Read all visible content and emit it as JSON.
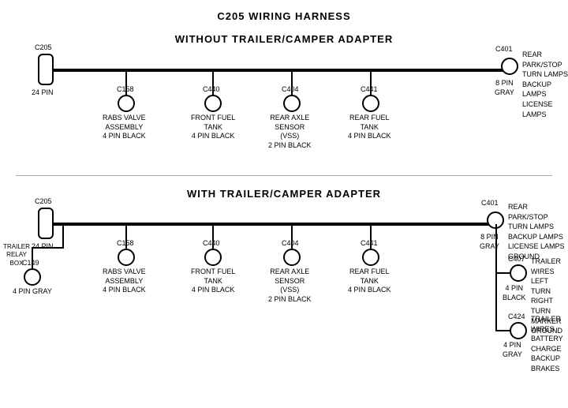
{
  "title": "C205 WIRING HARNESS",
  "section1": {
    "label": "WITHOUT  TRAILER/CAMPER  ADAPTER",
    "connectors": {
      "c205": {
        "label": "C205",
        "pin": "24 PIN"
      },
      "c401": {
        "label": "C401",
        "pin": "8 PIN\nGRAY",
        "desc": "REAR PARK/STOP\nTURN LAMPS\nBACKUP LAMPS\nLICENSE LAMPS"
      },
      "c158": {
        "label": "C158",
        "desc": "RABS VALVE\nASSEMBLY\n4 PIN BLACK"
      },
      "c440": {
        "label": "C440",
        "desc": "FRONT FUEL\nTANK\n4 PIN BLACK"
      },
      "c404": {
        "label": "C404",
        "desc": "REAR AXLE\nSENSOR\n(VSS)\n2 PIN BLACK"
      },
      "c441": {
        "label": "C441",
        "desc": "REAR FUEL\nTANK\n4 PIN BLACK"
      }
    }
  },
  "section2": {
    "label": "WITH  TRAILER/CAMPER  ADAPTER",
    "connectors": {
      "c205": {
        "label": "C205",
        "pin": "24 PIN"
      },
      "c401": {
        "label": "C401",
        "pin": "8 PIN\nGRAY",
        "desc": "REAR PARK/STOP\nTURN LAMPS\nBACKUP LAMPS\nLICENSE LAMPS\nGROUND"
      },
      "c158": {
        "label": "C158",
        "desc": "RABS VALVE\nASSEMBLY\n4 PIN BLACK"
      },
      "c440": {
        "label": "C440",
        "desc": "FRONT FUEL\nTANK\n4 PIN BLACK"
      },
      "c404": {
        "label": "C404",
        "desc": "REAR AXLE\nSENSOR\n(VSS)\n2 PIN BLACK"
      },
      "c441": {
        "label": "C441",
        "desc": "REAR FUEL\nTANK\n4 PIN BLACK"
      },
      "c149": {
        "label": "C149",
        "desc": "4 PIN GRAY"
      },
      "trailer_relay": {
        "label": "TRAILER\nRELAY\nBOX"
      },
      "c407": {
        "label": "C407",
        "pin": "4 PIN\nBLACK",
        "desc": "TRAILER WIRES\nLEFT TURN\nRIGHT TURN\nMARKER\nGROUND"
      },
      "c424": {
        "label": "C424",
        "pin": "4 PIN\nGRAY",
        "desc": "TRAILER WIRES\nBATTERY CHARGE\nBACKUP\nBRAKES"
      }
    }
  }
}
